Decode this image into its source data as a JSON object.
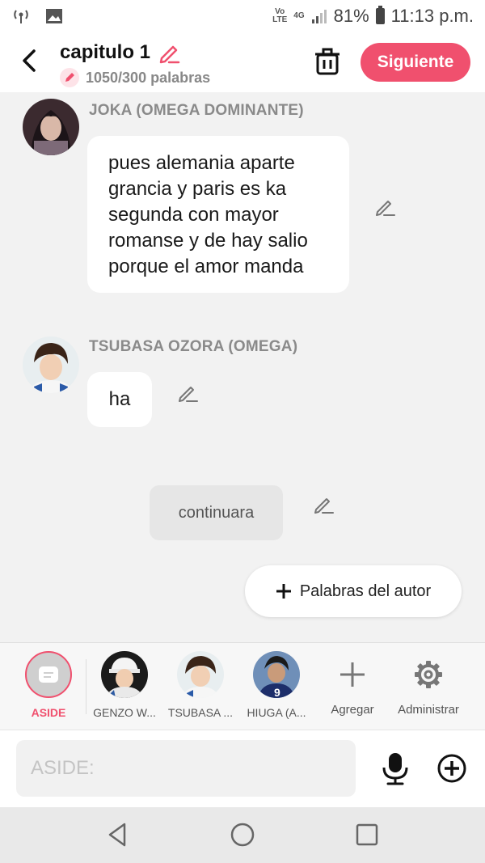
{
  "status_bar": {
    "battery": "81%",
    "time": "11:13 p.m.",
    "network_top": "Vo",
    "network_bottom": "LTE",
    "data_tag": "4G"
  },
  "header": {
    "title": "capitulo 1",
    "word_count": "1050/300 palabras",
    "next_label": "Siguiente"
  },
  "messages": [
    {
      "speaker": "JOKA (OMEGA DOMINANTE)",
      "lines": [
        "pues alemania aparte",
        "grancia y paris es ka",
        "segunda con mayor",
        "romanse y de hay salio",
        "porque el amor manda"
      ]
    },
    {
      "speaker": "TSUBASA OZORA (OMEGA)",
      "text": "ha"
    }
  ],
  "narration": {
    "text": "continuara"
  },
  "author_words": {
    "label": "Palabras del autor"
  },
  "characters": [
    {
      "label": "ASIDE"
    },
    {
      "label": "GENZO W..."
    },
    {
      "label": "TSUBASA ..."
    },
    {
      "label": "HIUGA (A..."
    }
  ],
  "tools": {
    "add_label": "Agregar",
    "manage_label": "Administrar"
  },
  "input": {
    "placeholder": "ASIDE:"
  },
  "colors": {
    "accent": "#f0506e",
    "background": "#f2f2f2",
    "bubble": "#ffffff"
  }
}
